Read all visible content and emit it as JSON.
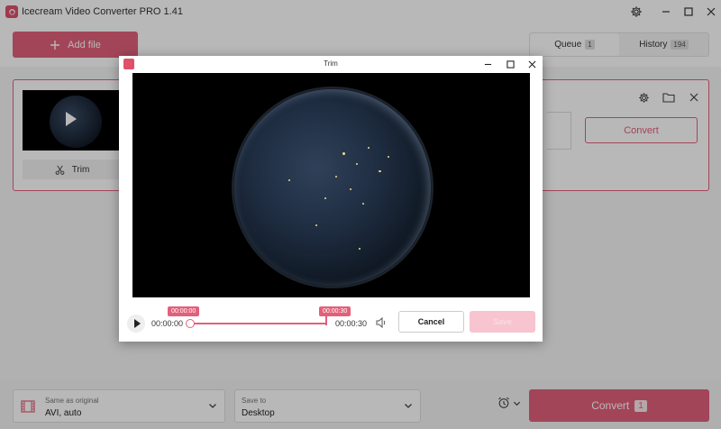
{
  "app": {
    "title": "Icecream Video Converter PRO 1.41"
  },
  "toolbar": {
    "add_file_label": "Add file",
    "tabs": [
      {
        "label": "Queue",
        "badge": "1"
      },
      {
        "label": "History",
        "badge": "194"
      }
    ]
  },
  "file_card": {
    "trim_label": "Trim",
    "convert_label": "Convert"
  },
  "bottom": {
    "format_caption": "Same as original",
    "format_value": "AVI, auto",
    "save_caption": "Save to",
    "save_value": "Desktop",
    "convert_label": "Convert",
    "convert_count": "1"
  },
  "dialog": {
    "title": "Trim",
    "time_start": "00:00:00",
    "time_end": "00:00:30",
    "marker_start": "00:00:00",
    "marker_end": "00:00:30",
    "trim_fraction": 1.0,
    "cancel_label": "Cancel",
    "save_label": "Save"
  },
  "colors": {
    "accent": "#e2607a",
    "accent_disabled": "#f7c4cf"
  },
  "icons": [
    "app-logo-icon",
    "gear-icon",
    "minimize-icon",
    "maximize-icon",
    "close-icon",
    "plus-icon",
    "scissors-icon",
    "folder-icon",
    "film-icon",
    "chevron-down-icon",
    "alarm-clock-icon",
    "play-icon",
    "volume-icon"
  ]
}
